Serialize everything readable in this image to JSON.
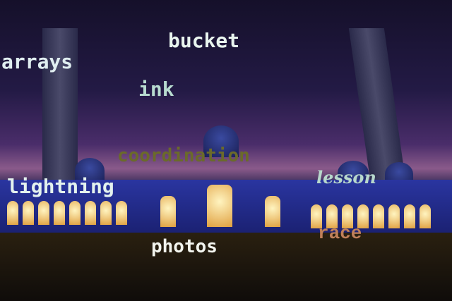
{
  "words": {
    "bucket": "bucket",
    "arrays": "arrays",
    "ink": "ink",
    "coordination": "coordination",
    "lightning": "lightning",
    "lesson": "lesson",
    "race": "race",
    "photos": "photos"
  },
  "colors": {
    "bucket": "#e8f4ee",
    "arrays": "#e0eef0",
    "ink": "#b8dcd0",
    "coordination": "#6b6a2a",
    "lightning": "#e4f2ee",
    "lesson": "#b8d8cc",
    "race": "#c0805a",
    "photos": "#f2f4ee"
  }
}
